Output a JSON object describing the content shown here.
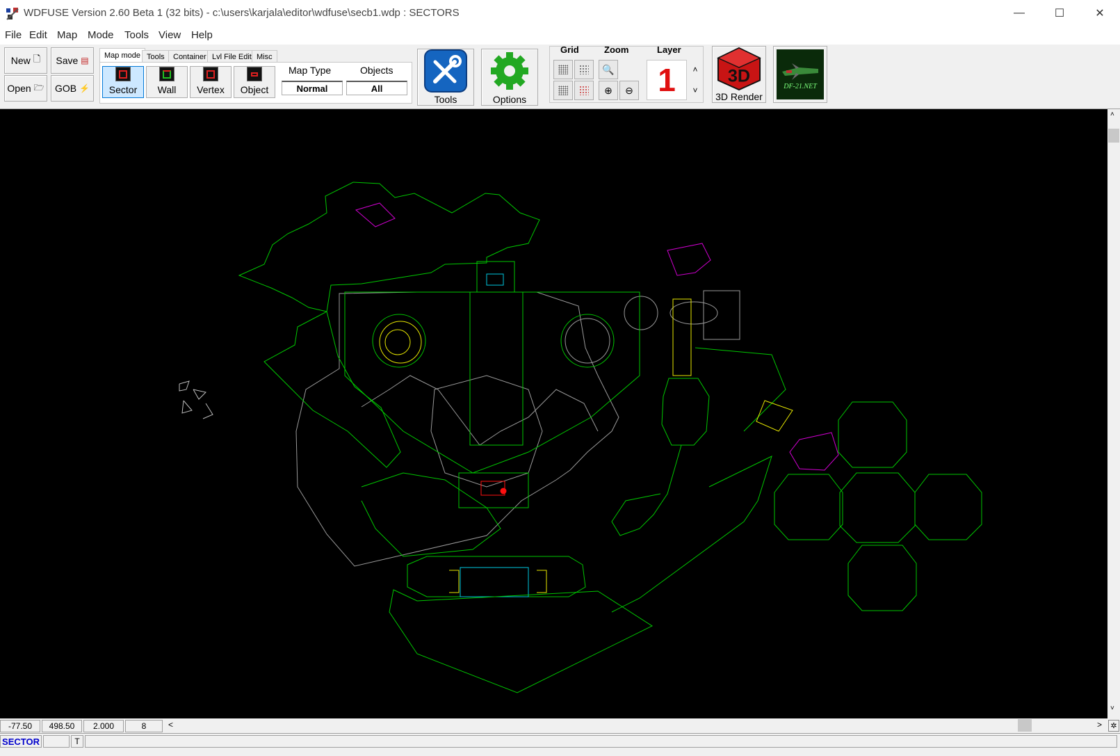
{
  "window": {
    "title": "WDFUSE Version 2.60 Beta 1 (32 bits) - c:\\users\\karjala\\editor\\wdfuse\\secb1.wdp : SECTORS",
    "minimize": "—",
    "maximize": "☐",
    "close": "✕"
  },
  "menu": [
    "File",
    "Edit",
    "Map",
    "Mode",
    "Tools",
    "View",
    "Help"
  ],
  "toolbar": {
    "new_label": "New",
    "save_label": "Save",
    "open_label": "Open",
    "gob_label": "GOB",
    "tabs": [
      "Map mode",
      "Tools",
      "Container",
      "Lvl File Edit",
      "Misc"
    ],
    "modes": [
      "Sector",
      "Wall",
      "Vertex",
      "Object"
    ],
    "map_type_label": "Map Type",
    "map_type_value": "Normal",
    "objects_label": "Objects",
    "objects_value": "All",
    "tools_label": "Tools",
    "options_label": "Options",
    "grid_label": "Grid",
    "zoom_label": "Zoom",
    "layer_label": "Layer",
    "layer_value": "1",
    "render_label": "3D Render",
    "render_icon_text": "3D",
    "df21_text": "DF-21.NET"
  },
  "status": {
    "x": "-77.50",
    "y": "498.50",
    "zoom": "2.000",
    "grid": "8",
    "mode": "SECTOR",
    "flag": "T"
  },
  "colors": {
    "canvas": "#000000",
    "sector_line": "#00c800",
    "gray_line": "#9a9a9a",
    "yellow_line": "#e8e800",
    "magenta_line": "#d000d0",
    "cyan_line": "#00c8e0",
    "red_selected": "#ff1010",
    "layer_digit": "#e01010",
    "status_mode": "#0000cc"
  }
}
